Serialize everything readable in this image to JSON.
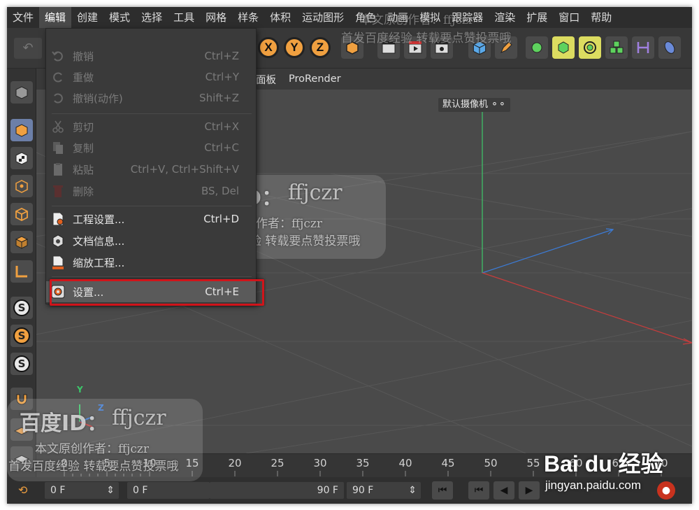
{
  "menubar": {
    "items": [
      "文件",
      "编辑",
      "创建",
      "模式",
      "选择",
      "工具",
      "网格",
      "样条",
      "体积",
      "运动图形",
      "角色",
      "动画",
      "模拟",
      "跟踪器",
      "渲染",
      "扩展",
      "窗口",
      "帮助"
    ],
    "active_index": 1
  },
  "toolbar": {
    "axis_x": "X",
    "axis_y": "Y",
    "axis_z": "Z"
  },
  "viewport": {
    "tabs": [
      "面板",
      "ProRender"
    ],
    "camera_label": "默认摄像机",
    "axis_indicator_y": "Y",
    "axis_indicator_z": "Z"
  },
  "timeline": {
    "ticks": [
      "0",
      "5",
      "10",
      "15",
      "20",
      "25",
      "30",
      "35",
      "40",
      "45",
      "50",
      "55",
      "60",
      "65",
      "70"
    ]
  },
  "transport": {
    "current_frame": "0 F",
    "start_frame": "0 F",
    "end_frame": "90 F",
    "max_frame": "90 F"
  },
  "edit_menu": {
    "items": [
      {
        "label": "撤销",
        "shortcut": "Ctrl+Z",
        "enabled": false,
        "icon": "undo-icon"
      },
      {
        "label": "重做",
        "shortcut": "Ctrl+Y",
        "enabled": false,
        "icon": "redo-icon"
      },
      {
        "label": "撤销(动作)",
        "shortcut": "Shift+Z",
        "enabled": false,
        "icon": "undo-action-icon"
      },
      {
        "label": "剪切",
        "shortcut": "Ctrl+X",
        "enabled": false,
        "icon": "scissors-icon"
      },
      {
        "label": "复制",
        "shortcut": "Ctrl+C",
        "enabled": false,
        "icon": "copy-icon"
      },
      {
        "label": "粘贴",
        "shortcut": "Ctrl+V, Ctrl+Shift+V",
        "enabled": false,
        "icon": "paste-icon"
      },
      {
        "label": "删除",
        "shortcut": "BS, Del",
        "enabled": false,
        "icon": "trash-icon"
      },
      {
        "label": "工程设置...",
        "shortcut": "Ctrl+D",
        "enabled": true,
        "icon": "project-settings-icon"
      },
      {
        "label": "文档信息...",
        "shortcut": "",
        "enabled": true,
        "icon": "document-info-icon"
      },
      {
        "label": "缩放工程...",
        "shortcut": "",
        "enabled": true,
        "icon": "scale-project-icon"
      },
      {
        "label": "设置...",
        "shortcut": "Ctrl+E",
        "enabled": true,
        "icon": "gear-icon"
      }
    ]
  },
  "watermarks": {
    "id_label": "百度ID：",
    "handle": "ffjczr",
    "author_line": "本文原创作者：ffjczr",
    "slogan": "首发百度经验 转载要点赞投票哦"
  },
  "brand": {
    "logo_text": "Bai du 经验",
    "domain": "jingyan.paidu.com"
  },
  "colors": {
    "accent_orange": "#f0a040",
    "highlight_red": "#d0141a",
    "axis_green": "#3cc86a",
    "axis_blue": "#3c7cd8",
    "axis_red": "#c83c3c"
  }
}
